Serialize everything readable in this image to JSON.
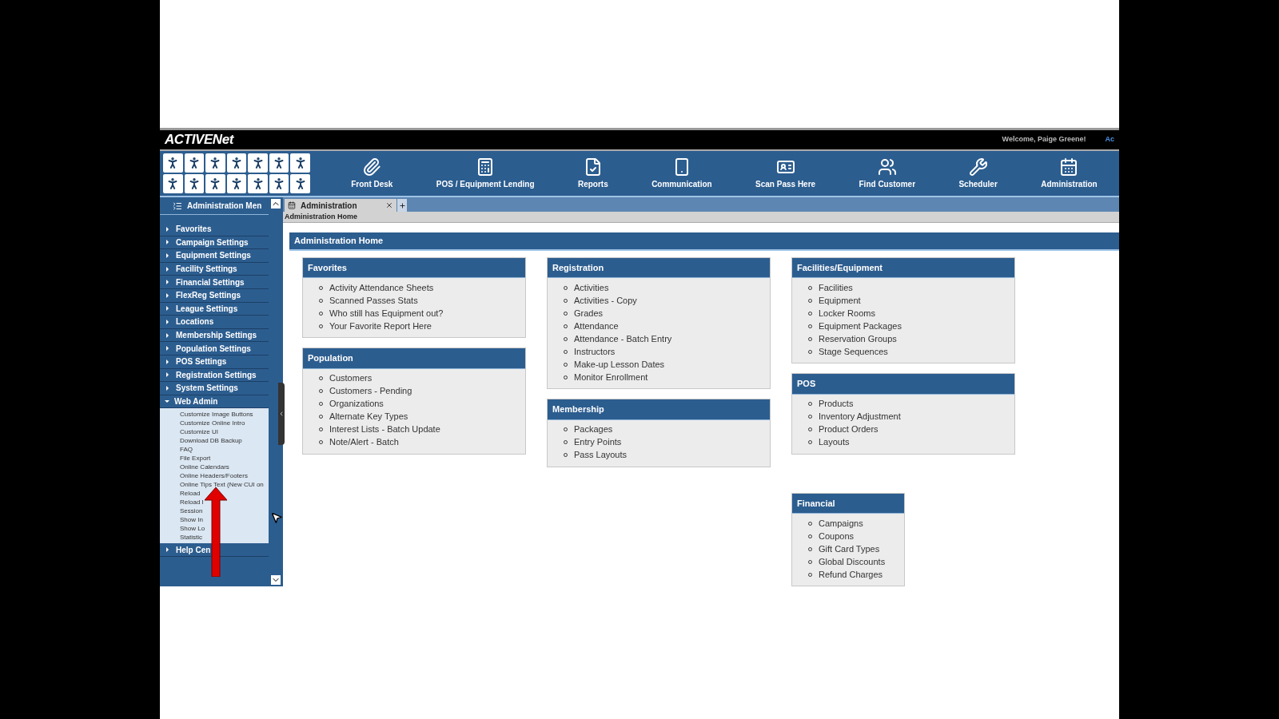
{
  "header": {
    "logo": "ACTIVENet",
    "welcome": "Welcome, Paige Greene!",
    "account_link": "Ac"
  },
  "nav": [
    {
      "label": "Front Desk"
    },
    {
      "label": "POS / Equipment Lending"
    },
    {
      "label": "Reports"
    },
    {
      "label": "Communication"
    },
    {
      "label": "Scan Pass Here"
    },
    {
      "label": "Find Customer"
    },
    {
      "label": "Scheduler"
    },
    {
      "label": "Administration"
    }
  ],
  "sidebar": {
    "title": "Administration Men",
    "items": [
      {
        "label": "Favorites",
        "expanded": false
      },
      {
        "label": "Campaign Settings",
        "expanded": false
      },
      {
        "label": "Equipment Settings",
        "expanded": false
      },
      {
        "label": "Facility Settings",
        "expanded": false
      },
      {
        "label": "Financial Settings",
        "expanded": false
      },
      {
        "label": "FlexReg Settings",
        "expanded": false
      },
      {
        "label": "League Settings",
        "expanded": false
      },
      {
        "label": "Locations",
        "expanded": false
      },
      {
        "label": "Membership Settings",
        "expanded": false
      },
      {
        "label": "Population Settings",
        "expanded": false
      },
      {
        "label": "POS Settings",
        "expanded": false
      },
      {
        "label": "Registration Settings",
        "expanded": false
      },
      {
        "label": "System Settings",
        "expanded": false
      },
      {
        "label": "Web Admin",
        "expanded": true,
        "children": [
          {
            "label": "Customize Image Buttons"
          },
          {
            "label": "Customize Online Intro"
          },
          {
            "label": "Customize UI"
          },
          {
            "label": "Download DB Backup"
          },
          {
            "label": "FAQ"
          },
          {
            "label": "File Export"
          },
          {
            "label": "Online Calendars"
          },
          {
            "label": "Online Headers/Footers"
          },
          {
            "label": "Online Tips Text (New CUI on"
          },
          {
            "label": "Reload"
          },
          {
            "label": "Reload I"
          },
          {
            "label": "Session"
          },
          {
            "label": "Show In"
          },
          {
            "label": "Show Lo"
          },
          {
            "label": "Statistic"
          }
        ]
      },
      {
        "label": "Help Cen",
        "expanded": false
      }
    ]
  },
  "tabs": [
    {
      "label": "Administration",
      "selected": true
    }
  ],
  "breadcrumb": "Administration Home",
  "page_title": "Administration Home",
  "columns": [
    [
      {
        "title": "Favorites",
        "compact": false,
        "items": [
          "Activity Attendance Sheets",
          "Scanned Passes Stats",
          "Who still has Equipment out?",
          "Your Favorite Report Here"
        ]
      },
      {
        "title": "Population",
        "compact": false,
        "items": [
          "Customers",
          "Customers - Pending",
          "Organizations",
          "Alternate Key Types",
          "Interest Lists - Batch Update",
          "Note/Alert - Batch"
        ]
      }
    ],
    [
      {
        "title": "Registration",
        "compact": false,
        "items": [
          "Activities",
          "Activities - Copy",
          "Grades",
          "Attendance",
          "Attendance - Batch Entry",
          "Instructors",
          "Make-up Lesson Dates",
          "Monitor Enrollment"
        ]
      },
      {
        "title": "Membership",
        "compact": false,
        "items": [
          "Packages",
          "Entry Points",
          "Pass Layouts"
        ]
      }
    ],
    [
      {
        "title": "Facilities/Equipment",
        "compact": false,
        "items": [
          "Facilities",
          "Equipment",
          "Locker Rooms",
          "Equipment Packages",
          "Reservation Groups",
          "Stage Sequences"
        ]
      },
      {
        "title": "POS",
        "compact": false,
        "items": [
          "Products",
          "Inventory Adjustment",
          "Product Orders",
          "Layouts"
        ]
      },
      {
        "title": "Financial",
        "compact": true,
        "items": [
          "Campaigns",
          "Coupons",
          "Gift Card Types",
          "Global Discounts",
          "Refund Charges"
        ]
      }
    ]
  ]
}
